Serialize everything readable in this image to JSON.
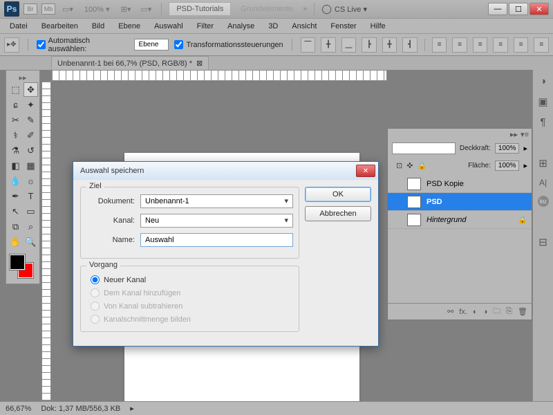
{
  "titlebar": {
    "zoom_pct": "100% ▾",
    "tabs": [
      "PSD-Tutorials",
      "Grundelemente"
    ],
    "cslive": "CS Live ▾"
  },
  "menu": [
    "Datei",
    "Bearbeiten",
    "Bild",
    "Ebene",
    "Auswahl",
    "Filter",
    "Analyse",
    "3D",
    "Ansicht",
    "Fenster",
    "Hilfe"
  ],
  "optbar": {
    "auto_select": "Automatisch auswählen:",
    "auto_select_value": "Ebene",
    "transform": "Transformationssteuerungen"
  },
  "doc_tab": "Unbenannt-1 bei 66,7% (PSD, RGB/8) *",
  "dialog": {
    "title": "Auswahl speichern",
    "ziel_legend": "Ziel",
    "doc_label": "Dokument:",
    "doc_value": "Unbenannt-1",
    "kanal_label": "Kanal:",
    "kanal_value": "Neu",
    "name_label": "Name:",
    "name_value": "Auswahl",
    "vorgang_legend": "Vorgang",
    "r1": "Neuer Kanal",
    "r2": "Dem Kanal hinzufügen",
    "r3": "Von Kanal subtrahieren",
    "r4": "Kanalschnittmenge bilden",
    "ok": "OK",
    "cancel": "Abbrechen"
  },
  "layers": {
    "deckkraft_label": "Deckkraft:",
    "deckkraft_value": "100%",
    "flaeche_label": "Fläche:",
    "flaeche_value": "100%",
    "items": [
      {
        "name": "PSD Kopie"
      },
      {
        "name": "PSD"
      },
      {
        "name": "Hintergrund"
      }
    ]
  },
  "status": {
    "zoom": "66,67%",
    "dok": "Dok: 1,37 MB/556,3 KB"
  }
}
